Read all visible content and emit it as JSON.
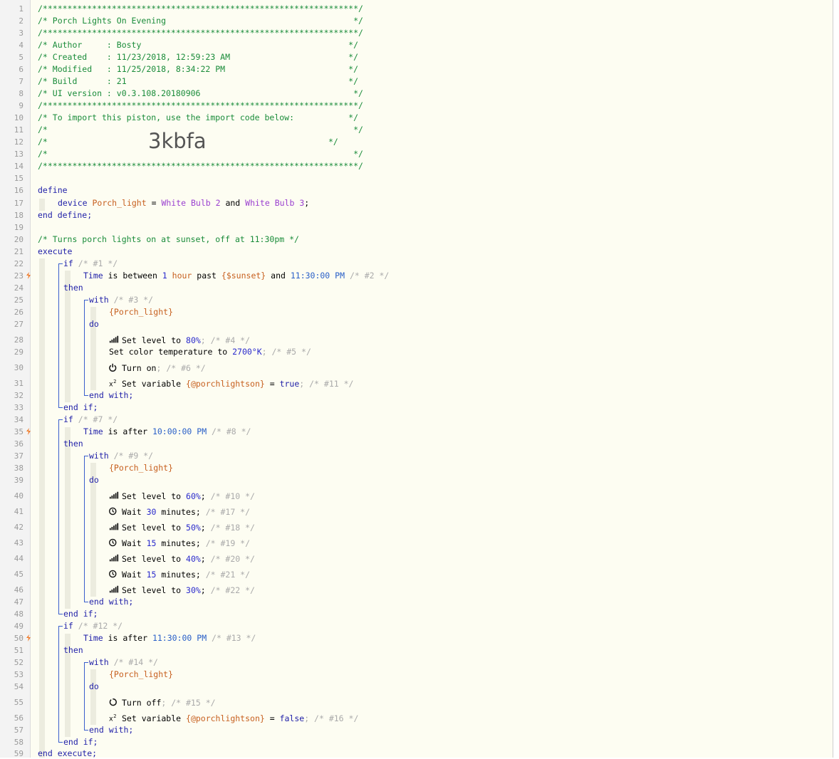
{
  "header": {
    "border_open": "/****************************************************************/",
    "title_line": "/* Porch Lights On Evening                                      */",
    "border_mid": "/****************************************************************/",
    "author_line": "/* Author     : Bosty                                          */",
    "created_line": "/* Created    : 11/23/2018, 12:59:23 AM                        */",
    "modified_line": "/* Modified   : 11/25/2018, 8:34:22 PM                         */",
    "build_line": "/* Build      : 21                                             */",
    "ui_line": "/* UI version : v0.3.108.20180906                               */",
    "border_mid2": "/****************************************************************/",
    "import_line": "/* To import this piston, use the import code below:           */",
    "blank1": "/*                                                              */",
    "code_prefix": "/*               ",
    "import_code": "3kbfa",
    "code_suffix": "*/",
    "blank2": "/*                                                              */",
    "border_close": "/****************************************************************/"
  },
  "define": {
    "kw_define": "define",
    "kw_device": "device",
    "var_name": "Porch_light",
    "eq": " = ",
    "dev1": "White Bulb 2",
    "and": " and ",
    "dev2": "White Bulb 3",
    "semi": ";",
    "end_define": "end define;"
  },
  "comment_line": "/* Turns porch lights on at sunset, off at 11:30pm */",
  "kw": {
    "execute": "execute",
    "end_execute": "end execute;",
    "if": "if",
    "then": "then",
    "with": "with",
    "do": "do",
    "end_with": "end with;",
    "end_if": "end if;",
    "time": "Time",
    "is_between": " is between ",
    "is_after": " is after ",
    "hour": " hour",
    "past": " past ",
    "and": " and ",
    "porch": "{Porch_light}"
  },
  "block1": {
    "if_c": " /* #1 */",
    "one": "1",
    "sunset": "{$sunset}",
    "end_time": "11:30:00 PM",
    "cond_c": " /* #2 */",
    "with_c": " /* #3 */",
    "a1_pre": "Set level to ",
    "a1_val": "80%",
    "a1_c": "; /* #4 */",
    "a2_pre": "Set color temperature to ",
    "a2_val": "2700°K",
    "a2_c": "; /* #5 */",
    "a3_pre": "Turn on",
    "a3_c": "; /* #6 */",
    "a4_pre": "Set variable ",
    "a4_var": "{@porchlightson}",
    "a4_eq": " = ",
    "a4_val": "true",
    "a4_c": "; /* #11 */"
  },
  "block2": {
    "if_c": " /* #7 */",
    "time": "10:00:00 PM",
    "cond_c": " /* #8 */",
    "with_c": " /* #9 */",
    "actions": [
      {
        "icon": "signal",
        "pre": "Set level to ",
        "val": "60%",
        "post": ";",
        "c": " /* #10 */"
      },
      {
        "icon": "clock",
        "pre": "Wait ",
        "val": "30",
        "post": " minutes;",
        "c": " /* #17 */"
      },
      {
        "icon": "signal",
        "pre": "Set level to ",
        "val": "50%",
        "post": ";",
        "c": " /* #18 */"
      },
      {
        "icon": "clock",
        "pre": "Wait ",
        "val": "15",
        "post": " minutes;",
        "c": " /* #19 */"
      },
      {
        "icon": "signal",
        "pre": "Set level to ",
        "val": "40%",
        "post": ";",
        "c": " /* #20 */"
      },
      {
        "icon": "clock",
        "pre": "Wait ",
        "val": "15",
        "post": " minutes;",
        "c": " /* #21 */"
      },
      {
        "icon": "signal",
        "pre": "Set level to ",
        "val": "30%",
        "post": ";",
        "c": " /* #22 */"
      }
    ]
  },
  "block3": {
    "if_c": " /* #12 */",
    "time": "11:30:00 PM",
    "cond_c": " /* #13 */",
    "with_c": " /* #14 */",
    "a1_pre": "Turn off",
    "a1_c": "; /* #15 */",
    "a2_pre": "Set variable ",
    "a2_var": "{@porchlightson}",
    "a2_eq": " = ",
    "a2_val": "false",
    "a2_c": "; /* #16 */"
  },
  "line_numbers": [
    "1",
    "2",
    "3",
    "4",
    "5",
    "6",
    "7",
    "8",
    "9",
    "10",
    "11",
    "12",
    "13",
    "14",
    "15",
    "16",
    "17",
    "18",
    "19",
    "20",
    "21",
    "22",
    "23",
    "24",
    "25",
    "26",
    "27",
    "28",
    "29",
    "30",
    "31",
    "32",
    "33",
    "34",
    "35",
    "36",
    "37",
    "38",
    "39",
    "40",
    "41",
    "42",
    "43",
    "44",
    "45",
    "46",
    "47",
    "48",
    "49",
    "50",
    "51",
    "52",
    "53",
    "54",
    "55",
    "56",
    "57",
    "58",
    "59"
  ],
  "colors": {
    "comment": "#1a8c3a",
    "keyword": "#1f1fa8",
    "device": "#9a3fd0",
    "variable": "#c7601f",
    "marker": "#f07b2a"
  }
}
